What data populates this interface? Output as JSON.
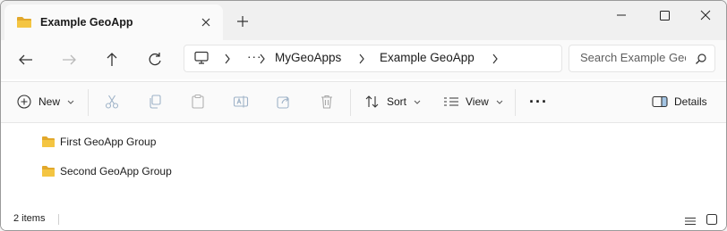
{
  "tab": {
    "title": "Example GeoApp"
  },
  "breadcrumb": {
    "ellipsis": "···",
    "items": [
      "MyGeoApps",
      "Example GeoApp"
    ]
  },
  "search": {
    "placeholder": "Search Example GeoApp"
  },
  "toolbar": {
    "new_label": "New",
    "sort_label": "Sort",
    "view_label": "View",
    "more_label": "···",
    "details_label": "Details"
  },
  "files": [
    {
      "name": "First GeoApp Group",
      "icon": "folder-icon"
    },
    {
      "name": "Second GeoApp Group",
      "icon": "folder-icon"
    }
  ],
  "status": {
    "item_count": "2 items"
  },
  "colors": {
    "folder": "#f4c542",
    "folder_dark": "#e2a82b",
    "accent": "#005fb8"
  }
}
